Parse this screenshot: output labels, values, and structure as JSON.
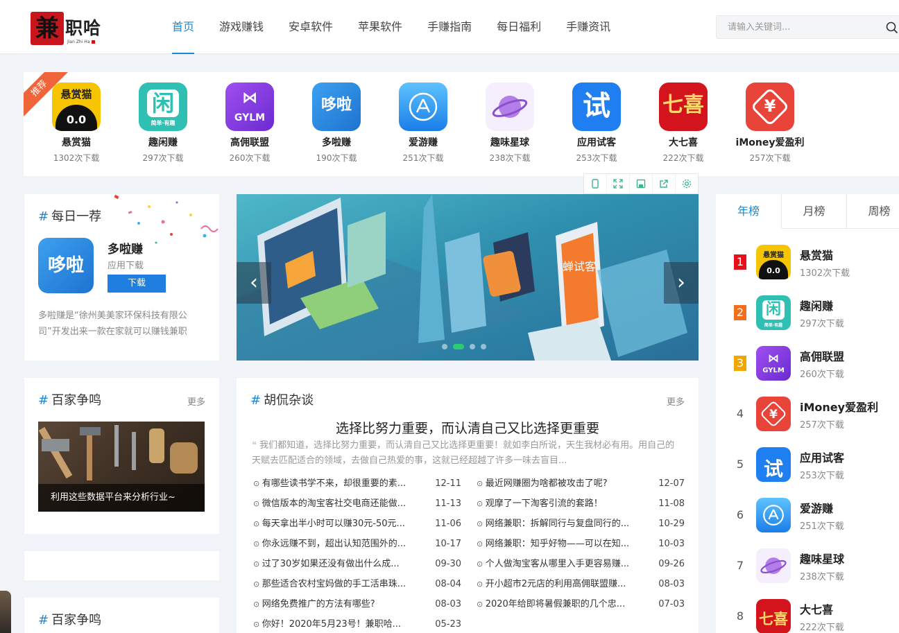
{
  "logo": {
    "text": "兼职哈",
    "pinyin": "Jian Zhi Ha"
  },
  "nav": [
    "首页",
    "游戏赚钱",
    "安卓软件",
    "苹果软件",
    "手赚指南",
    "每日福利",
    "手赚资讯"
  ],
  "search": {
    "placeholder": "请输入关键词..."
  },
  "recommend": {
    "ribbon": "推荐",
    "apps": [
      {
        "name": "悬赏猫",
        "downloads": "1302次下载",
        "color": "#f6c400"
      },
      {
        "name": "趣闲赚",
        "downloads": "297次下载",
        "color": "#2fbfb3"
      },
      {
        "name": "高佣联盟",
        "downloads": "260次下载",
        "color": "#8a3ee0"
      },
      {
        "name": "多啦赚",
        "downloads": "190次下载",
        "color": "#2a8fe8"
      },
      {
        "name": "爱游赚",
        "downloads": "251次下载",
        "color": "#3aa3f2"
      },
      {
        "name": "趣味星球",
        "downloads": "238次下载",
        "color": "#b57de8"
      },
      {
        "name": "应用试客",
        "downloads": "253次下载",
        "color": "#1f7ff0"
      },
      {
        "name": "大七喜",
        "downloads": "222次下载",
        "color": "#d4141c"
      },
      {
        "name": "iMoney爱盈利",
        "downloads": "257次下载",
        "color": "#e8443a"
      }
    ]
  },
  "daily": {
    "title": "每日一荐",
    "app_name": "多啦赚",
    "category": "应用下载",
    "download": "下载",
    "icon_text": "哆啦",
    "desc": "多啦赚是“徐州美美家环保科技有限公司”开发出来一款在家就可以赚钱兼职"
  },
  "carousel": {
    "phone_text": "蝉试客"
  },
  "baijia": {
    "title": "百家争鸣",
    "more": "更多",
    "caption": "利用这些数据平台来分析行业~"
  },
  "baijia2": {
    "title": "百家争鸣"
  },
  "hukan": {
    "title": "胡侃杂谈",
    "more": "更多",
    "headline": "选择比努力重要，而认清自己又比选择更重要",
    "summary": "我们都知道，选择比努力重要，而认清自己又比选择更重要！就如李白所说，天生我材必有用。用自己的天赋去匹配适合的领域，去做自己热爱的事，这就已经超越了许多一味去盲目...",
    "left": [
      {
        "title": "有哪些读书学不来，却很重要的素...",
        "date": "12-11"
      },
      {
        "title": "微信版本的淘宝客社交电商还能做...",
        "date": "11-13"
      },
      {
        "title": "每天拿出半小时可以赚30元-50元...",
        "date": "11-06"
      },
      {
        "title": "你永远赚不到，超出认知范围外的...",
        "date": "10-17"
      },
      {
        "title": "过了30岁如果还没有做出什么成...",
        "date": "09-30"
      },
      {
        "title": "那些适合农村宝妈做的手工活串珠...",
        "date": "08-04"
      },
      {
        "title": "网络免费推广的方法有哪些?",
        "date": "08-03"
      },
      {
        "title": "你好！2020年5月23号！兼职哈...",
        "date": "05-23"
      }
    ],
    "right": [
      {
        "title": "最近网赚圈为啥都被攻击了呢?",
        "date": "12-07"
      },
      {
        "title": "观摩了一下淘客引流的套路！",
        "date": "11-08"
      },
      {
        "title": "网络兼职：拆解同行与复盘同行的...",
        "date": "10-29"
      },
      {
        "title": "网络兼职：知乎好物——可以在知...",
        "date": "10-03"
      },
      {
        "title": "个人做淘宝客从哪里入手更容易赚...",
        "date": "09-26"
      },
      {
        "title": "开小超市2元店的利用高佣联盟赚...",
        "date": "08-03"
      },
      {
        "title": "2020年给即将暑假兼职的几个忠...",
        "date": "07-03"
      }
    ]
  },
  "ranking": {
    "tabs": [
      "年榜",
      "月榜",
      "周榜"
    ],
    "items": [
      {
        "rank": "1",
        "name": "悬赏猫",
        "downloads": "1302次下载"
      },
      {
        "rank": "2",
        "name": "趣闲赚",
        "downloads": "297次下载"
      },
      {
        "rank": "3",
        "name": "高佣联盟",
        "downloads": "260次下载"
      },
      {
        "rank": "4",
        "name": "iMoney爱盈利",
        "downloads": "257次下载"
      },
      {
        "rank": "5",
        "name": "应用试客",
        "downloads": "253次下载"
      },
      {
        "rank": "6",
        "name": "爱游赚",
        "downloads": "251次下载"
      },
      {
        "rank": "7",
        "name": "趣味星球",
        "downloads": "238次下载"
      },
      {
        "rank": "8",
        "name": "大七喜",
        "downloads": "222次下载"
      }
    ]
  }
}
